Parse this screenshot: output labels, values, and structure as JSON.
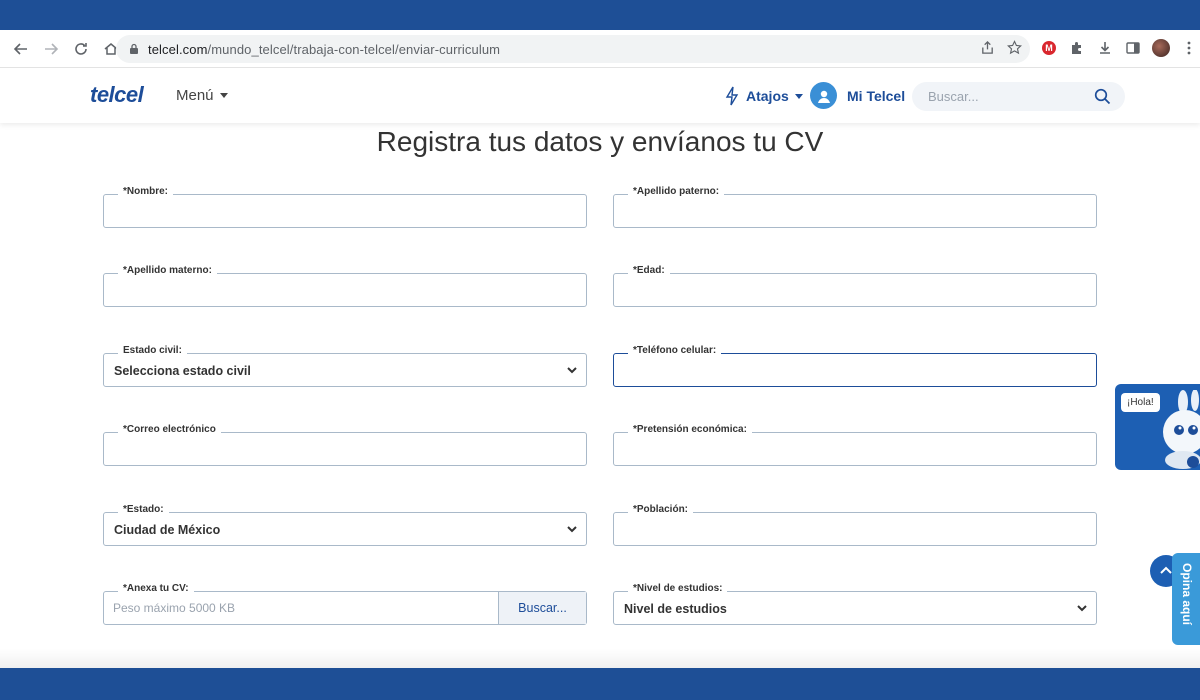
{
  "browser": {
    "url_host": "telcel.com",
    "url_path": "/mundo_telcel/trabaja-con-telcel/enviar-curriculum"
  },
  "header": {
    "logo": "telcel",
    "menu_label": "Menú",
    "atajos_label": "Atajos",
    "mi_telcel_label": "Mi Telcel",
    "search_placeholder": "Buscar..."
  },
  "form": {
    "title": "Registra tus datos y envíanos tu CV",
    "nombre": {
      "label": "*Nombre:",
      "value": ""
    },
    "apellido_paterno": {
      "label": "*Apellido paterno:",
      "value": ""
    },
    "apellido_materno": {
      "label": "*Apellido materno:",
      "value": ""
    },
    "edad": {
      "label": "*Edad:",
      "value": ""
    },
    "estado_civil": {
      "label": "Estado civil:",
      "value": "Selecciona estado civil"
    },
    "telefono_celular": {
      "label": "*Teléfono celular:",
      "value": ""
    },
    "correo": {
      "label": "*Correo electrónico",
      "value": ""
    },
    "pretension": {
      "label": "*Pretensión económica:",
      "value": ""
    },
    "estado": {
      "label": "*Estado:",
      "value": "Ciudad de México"
    },
    "poblacion": {
      "label": "*Población:",
      "value": ""
    },
    "anexa_cv": {
      "label": "*Anexa tu CV:",
      "placeholder": "Peso máximo 5000 KB",
      "button_label": "Buscar..."
    },
    "nivel_estudios": {
      "label": "*Nivel de estudios:",
      "value": "Nivel de estudios"
    }
  },
  "widgets": {
    "chat_greeting": "¡Hola!",
    "feedback_label": "Opina aquí"
  },
  "colors": {
    "brand_blue": "#1d4d99",
    "frame_blue": "#1e4f96",
    "field_border": "#a9b9c9"
  }
}
